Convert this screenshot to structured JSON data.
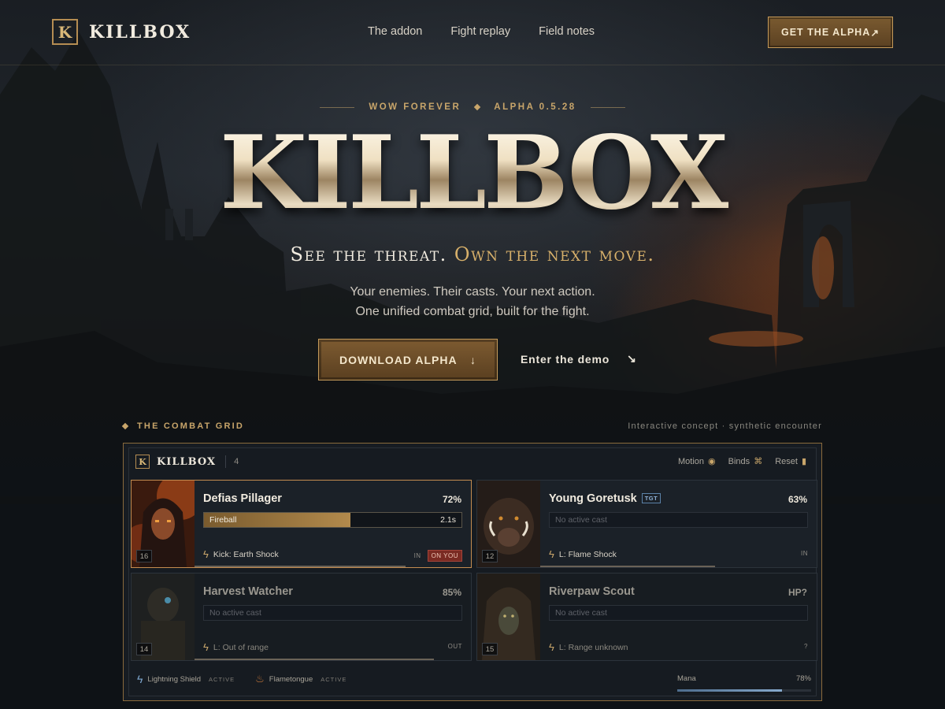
{
  "header": {
    "brand": "KILLBOX",
    "logo_letter": "K",
    "nav": [
      "The addon",
      "Fight replay",
      "Field notes"
    ],
    "cta": "GET THE ALPHA",
    "cta_icon": "↗"
  },
  "hero": {
    "eyebrow_left": "WOW FOREVER",
    "eyebrow_right": "ALPHA 0.5.28",
    "title": "KILLBOX",
    "tagline_white": "See the threat.",
    "tagline_gold": "Own the next move.",
    "sub_line1": "Your enemies. Their casts. Your next action.",
    "sub_line2": "One unified combat grid, built for the fight.",
    "primary_button": "DOWNLOAD ALPHA",
    "primary_icon": "↓",
    "secondary_button": "Enter the demo",
    "secondary_icon": "↘"
  },
  "section": {
    "label": "THE COMBAT GRID",
    "note": "Interactive concept · synthetic encounter"
  },
  "panel": {
    "brand": "KILLBOX",
    "logo_letter": "K",
    "count": "4",
    "controls": [
      {
        "label": "Motion",
        "icon": "◉"
      },
      {
        "label": "Binds",
        "icon": "⌘"
      },
      {
        "label": "Reset",
        "icon": "▮"
      }
    ],
    "cards": [
      {
        "name": "Defias Pillager",
        "hp": "72%",
        "hp_fraction": 0.76,
        "level": "16",
        "cast": "Fireball",
        "cast_time": "2.1s",
        "cast_progress": 0.57,
        "action": "Kick: Earth Shock",
        "flags": [
          "IN",
          "ON YOU"
        ],
        "tag": ""
      },
      {
        "name": "Young Goretusk",
        "hp": "63%",
        "hp_fraction": 0.63,
        "level": "12",
        "cast": "No active cast",
        "cast_time": "",
        "cast_progress": 0,
        "action": "L: Flame Shock",
        "flags": [
          "IN"
        ],
        "tag": "TGT"
      },
      {
        "name": "Harvest Watcher",
        "hp": "85%",
        "hp_fraction": 0.86,
        "level": "14",
        "cast": "No active cast",
        "cast_time": "",
        "cast_progress": 0,
        "action": "L: Out of range",
        "flags": [
          "OUT"
        ],
        "tag": ""
      },
      {
        "name": "Riverpaw Scout",
        "hp": "HP?",
        "hp_fraction": 0,
        "level": "15",
        "cast": "No active cast",
        "cast_time": "",
        "cast_progress": 0,
        "action": "L: Range unknown",
        "flags": [
          "?"
        ],
        "tag": ""
      }
    ],
    "buffs": [
      {
        "name": "Lightning Shield",
        "state": "ACTIVE",
        "icon": "lightning-icon"
      },
      {
        "name": "Flametongue",
        "state": "ACTIVE",
        "icon": "flame-icon"
      }
    ],
    "mana": {
      "label": "Mana",
      "value": "78%",
      "fraction": 0.78
    }
  },
  "colors": {
    "accent_gold": "#c8a56a",
    "danger": "#7a2a22",
    "mana": "#86a9cc"
  }
}
